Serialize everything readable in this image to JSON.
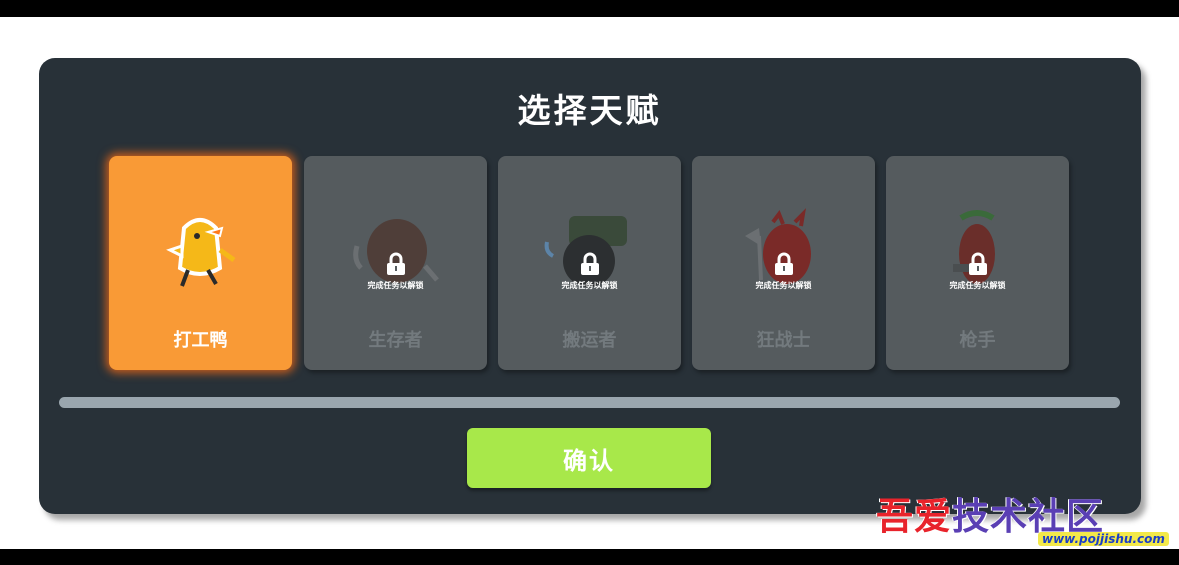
{
  "dialog": {
    "title": "选择天赋",
    "cards": [
      {
        "name": "打工鸭",
        "locked": false,
        "selected": true,
        "hint": ""
      },
      {
        "name": "生存者",
        "locked": true,
        "selected": false,
        "hint": "完成任务以解锁"
      },
      {
        "name": "搬运者",
        "locked": true,
        "selected": false,
        "hint": "完成任务以解锁"
      },
      {
        "name": "狂战士",
        "locked": true,
        "selected": false,
        "hint": "完成任务以解锁"
      },
      {
        "name": "枪手",
        "locked": true,
        "selected": false,
        "hint": "完成任务以解锁"
      }
    ],
    "confirm_label": "确认"
  },
  "colors": {
    "panel": "#283138",
    "selected_card": "#f99a36",
    "locked_card": "#555b5e",
    "confirm_button": "#a8e84a",
    "progress_track": "#9aa6ae"
  },
  "icons": {
    "lock": "lock-icon",
    "selected_character": "duck-character-icon"
  },
  "watermark": {
    "title_red": "吾爱",
    "title_blue": "技术社区",
    "url": "www.pojjishu.com"
  }
}
